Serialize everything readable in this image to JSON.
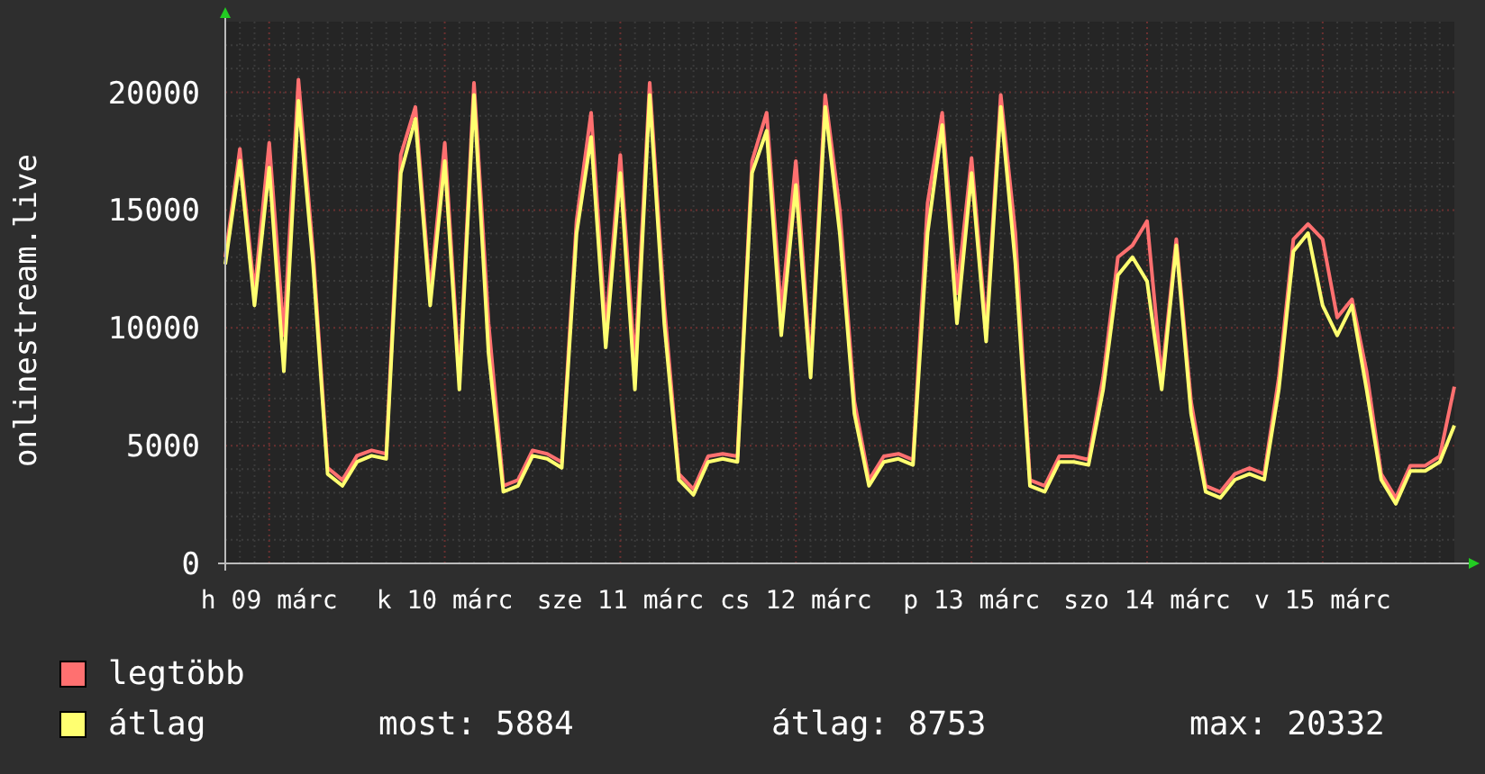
{
  "graph": {
    "chart_data": {
      "type": "line",
      "grid": true,
      "ylabel": "onlinestream.live",
      "ylim": [
        0,
        23000
      ],
      "yticks": [
        0,
        5000,
        10000,
        15000,
        20000
      ],
      "categories": [
        null,
        null,
        null,
        "h 09 márc",
        null,
        null,
        null,
        null,
        null,
        null,
        null,
        null,
        null,
        null,
        null,
        "k 10 márc",
        null,
        null,
        null,
        null,
        null,
        null,
        null,
        null,
        null,
        null,
        null,
        "sze 11 márc",
        null,
        null,
        null,
        null,
        null,
        null,
        null,
        null,
        null,
        null,
        null,
        "cs 12 márc",
        null,
        null,
        null,
        null,
        null,
        null,
        null,
        null,
        null,
        null,
        null,
        "p 13 márc",
        null,
        null,
        null,
        null,
        null,
        null,
        null,
        null,
        null,
        null,
        null,
        "szo 14 márc",
        null,
        null,
        null,
        null,
        null,
        null,
        null,
        null,
        null,
        null,
        null,
        "v 15 márc",
        null,
        null,
        null,
        null,
        null,
        null,
        null,
        null,
        null
      ],
      "series": [
        {
          "name": "legtöbb",
          "color": "#ff7070",
          "values": [
            13000,
            17600,
            11500,
            17850,
            9680,
            20530,
            13250,
            4060,
            3540,
            4570,
            4800,
            4650,
            17340,
            19380,
            11460,
            17850,
            7890,
            20400,
            10190,
            3290,
            3540,
            4800,
            4650,
            4300,
            14530,
            19130,
            9930,
            17340,
            8400,
            20400,
            10950,
            3800,
            3150,
            4550,
            4650,
            4550,
            17080,
            19130,
            10700,
            17080,
            8400,
            19890,
            15000,
            6870,
            3540,
            4550,
            4650,
            4400,
            15300,
            19130,
            11460,
            17210,
            9930,
            19890,
            14020,
            3540,
            3290,
            4550,
            4550,
            4400,
            7890,
            13000,
            13500,
            14530,
            7890,
            13760,
            6870,
            3290,
            3030,
            3800,
            4050,
            3800,
            7890,
            13760,
            14400,
            13760,
            10440,
            11210,
            8140,
            3800,
            2780,
            4150,
            4150,
            4550,
            7500
          ]
        },
        {
          "name": "átlag",
          "color": "#ffff70",
          "values": [
            12700,
            17100,
            10950,
            16800,
            8150,
            19640,
            12740,
            3800,
            3290,
            4310,
            4570,
            4440,
            16570,
            18870,
            10950,
            17080,
            7380,
            19890,
            8910,
            3040,
            3290,
            4570,
            4440,
            4060,
            14000,
            18100,
            9170,
            16570,
            7380,
            19890,
            10190,
            3550,
            2910,
            4310,
            4440,
            4310,
            16570,
            18360,
            9680,
            16060,
            7890,
            19380,
            14000,
            6360,
            3290,
            4310,
            4440,
            4180,
            14020,
            18610,
            10190,
            16570,
            9420,
            19380,
            12740,
            3290,
            3040,
            4310,
            4310,
            4180,
            7380,
            12230,
            13000,
            11970,
            7380,
            13510,
            6360,
            3040,
            2780,
            3550,
            3800,
            3550,
            7380,
            13250,
            14020,
            10950,
            9680,
            10950,
            7380,
            3550,
            2530,
            3930,
            3930,
            4310,
            5850
          ]
        }
      ]
    }
  },
  "stats": [
    "most: 5884",
    "átlag: 8753",
    "max: 20332"
  ]
}
